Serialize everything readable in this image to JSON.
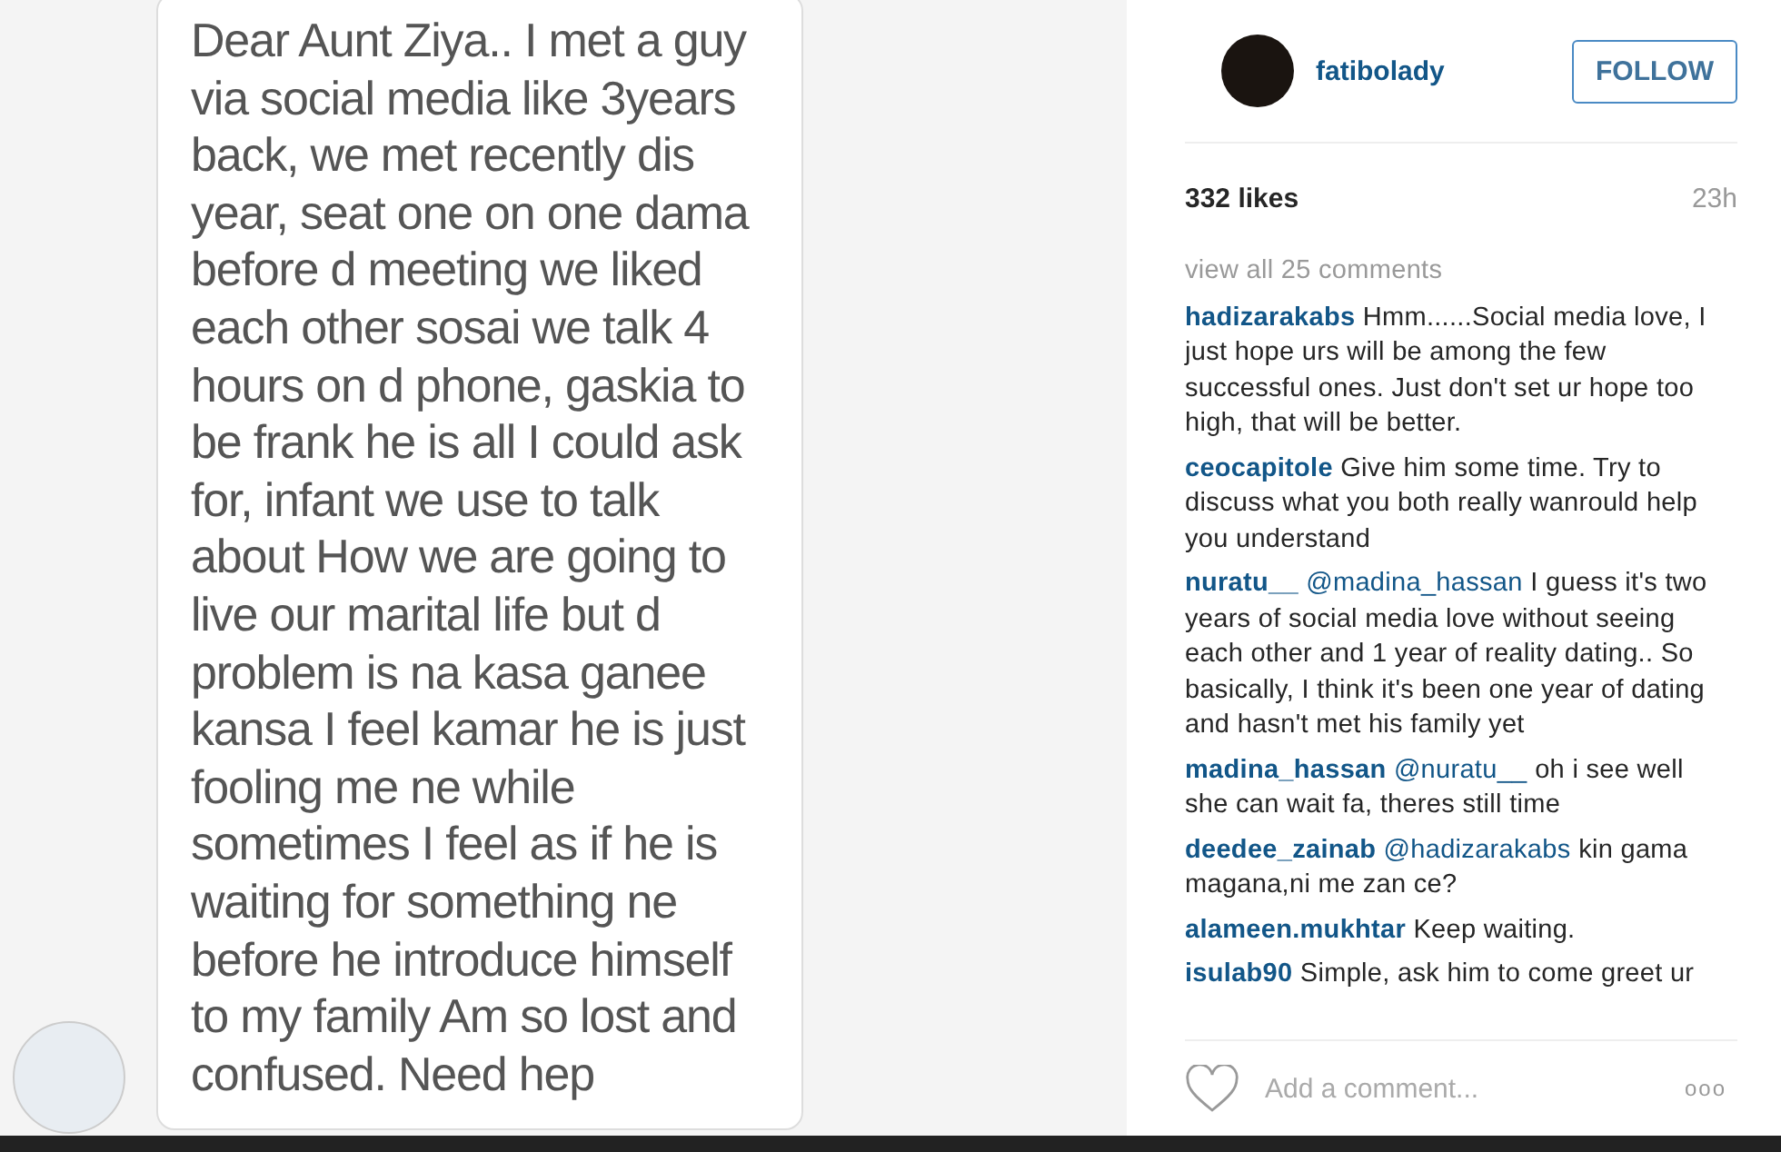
{
  "message": {
    "lines": [
      "Dear Aunt Ziya..  I met a guy",
      "via social media like 3years",
      "back, we met recently dis",
      "year,  seat one on one dama",
      "before d meeting we liked",
      "each other sosai we talk 4",
      "hours on d phone, gaskia to",
      "be frank he is all I could ask",
      "for, infant we use to talk",
      "about How we are going to",
      "live our marital life but d",
      "problem is na kasa ganee",
      "kansa I feel kamar he is just",
      "fooling me ne while",
      "sometimes I feel as if he is",
      "waiting for something ne",
      "before he introduce himself",
      "to my family Am so lost and",
      "confused.  Need hep"
    ]
  },
  "post": {
    "username": "fatibolady",
    "follow_button": "FOLLOW",
    "likes": "332 likes",
    "time": "23h",
    "view_all": "view all 25 comments",
    "comments": [
      {
        "user": "hadizarakabs",
        "text": "Hmm......Social media love, I just hope urs will be among the few successful ones. Just don't set ur hope too high, that will be better."
      },
      {
        "user": "ceocapitole",
        "text": "Give him some time. Try to discuss what you both really wanrould help you understand"
      },
      {
        "user": "nuratu__",
        "mention": "@madina_hassan",
        "text": "I guess it's two years of social media love without seeing each other and 1 year of reality dating.. So basically, I think it's been one year of dating and hasn't met his family yet"
      },
      {
        "user": "madina_hassan",
        "mention": "@nuratu__",
        "text": "oh i see well she can wait fa, theres still time"
      },
      {
        "user": "deedee_zainab",
        "mention": "@hadizarakabs",
        "text": "kin gama magana,ni me zan ce?"
      },
      {
        "user": "alameen.mukhtar",
        "text": "Keep waiting."
      },
      {
        "user": "isulab90",
        "text": "Simple, ask him to come greet ur"
      }
    ],
    "comment_placeholder": "Add a comment...",
    "more_button": "ooo"
  }
}
